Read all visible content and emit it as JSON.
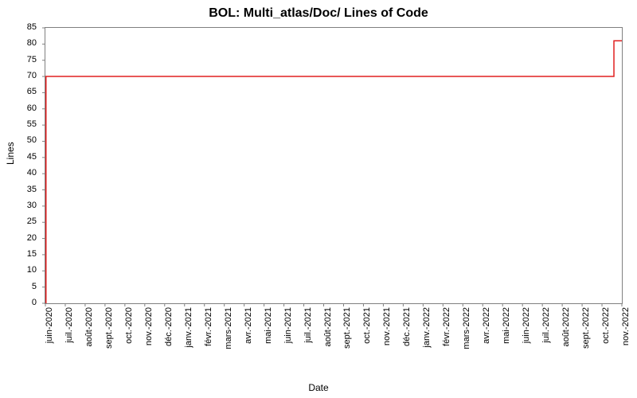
{
  "chart_data": {
    "type": "line",
    "title": "BOL: Multi_atlas/Doc/ Lines of Code",
    "xlabel": "Date",
    "ylabel": "Lines",
    "ylim": [
      0,
      85
    ],
    "y_ticks": [
      0,
      5,
      10,
      15,
      20,
      25,
      30,
      35,
      40,
      45,
      50,
      55,
      60,
      65,
      70,
      75,
      80,
      85
    ],
    "x_categories": [
      "juin-2020",
      "juil.-2020",
      "août-2020",
      "sept.-2020",
      "oct.-2020",
      "nov.-2020",
      "déc.-2020",
      "janv.-2021",
      "févr.-2021",
      "mars-2021",
      "avr.-2021",
      "mai-2021",
      "juin-2021",
      "juil.-2021",
      "août-2021",
      "sept.-2021",
      "oct.-2021",
      "nov.-2021",
      "déc.-2021",
      "janv.-2022",
      "févr.-2022",
      "mars-2022",
      "avr.-2022",
      "mai-2022",
      "juin-2022",
      "juil.-2022",
      "août-2022",
      "sept.-2022",
      "oct.-2022",
      "nov.-2022"
    ],
    "series": [
      {
        "name": "Lines",
        "color": "#e02020",
        "points": [
          {
            "x": 0.03,
            "y": 0
          },
          {
            "x": 0.03,
            "y": 70
          },
          {
            "x": 28.6,
            "y": 70
          },
          {
            "x": 28.6,
            "y": 81
          },
          {
            "x": 29.0,
            "y": 81
          }
        ]
      }
    ]
  }
}
